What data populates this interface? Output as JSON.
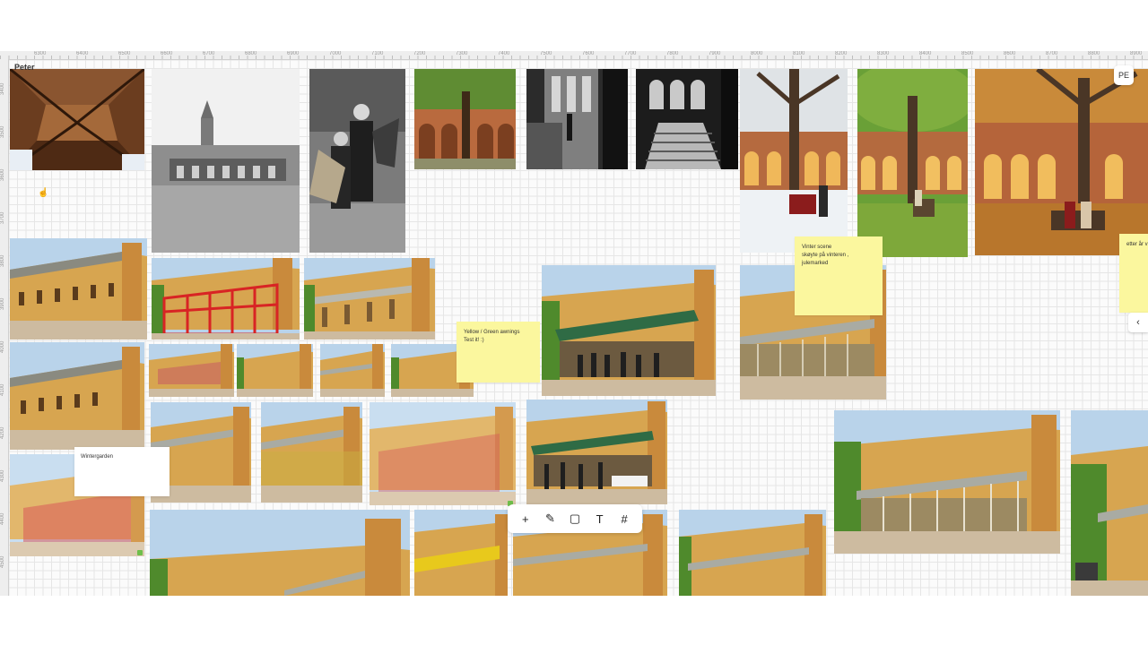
{
  "ruler": {
    "top_ticks": [
      "6300",
      "6400",
      "6500",
      "6600",
      "6700",
      "6800",
      "6900",
      "7000",
      "7100",
      "7200",
      "7300",
      "7400",
      "7500",
      "7600",
      "7700",
      "7800",
      "7900",
      "8000",
      "8100",
      "8200",
      "8300",
      "8400",
      "8500",
      "8600",
      "8700",
      "8800",
      "8900"
    ],
    "left_ticks": [
      "3400",
      "3500",
      "3600",
      "3700",
      "3800",
      "3900",
      "4000",
      "4100",
      "4200",
      "4300",
      "4400",
      "4500",
      "4600"
    ]
  },
  "cursor": {
    "user_label": "Peter"
  },
  "avatar": {
    "initials": "PE"
  },
  "sticky_notes": [
    {
      "text_lines": [
        "Vinter scene",
        "skøyte på vinteren ,",
        "julemarked"
      ]
    },
    {
      "text_lines": [
        "Yellow / Green awnings",
        "Test it! :)"
      ]
    },
    {
      "text_lines": [
        "etter år v"
      ]
    }
  ],
  "cards": [
    {
      "label": "Wintergarden"
    }
  ],
  "toolbar": {
    "tools": [
      {
        "name": "add",
        "glyph": "+"
      },
      {
        "name": "pen",
        "glyph": "✎"
      },
      {
        "name": "sticky-note",
        "glyph": "▢"
      },
      {
        "name": "text",
        "glyph": "T"
      },
      {
        "name": "frame",
        "glyph": "#"
      }
    ]
  },
  "side_tab": {
    "glyph": "‹"
  },
  "colors": {
    "sky": "#b9d3ea",
    "building_ochre": "#d7a550",
    "roof_gray": "#8a8a80",
    "ground": "#cdbba0",
    "red_markup": "#d82424",
    "green_awning": "#2f6b45",
    "tree_green": "#6f9a3a",
    "autumn_ground": "#b8762c",
    "sticky_yellow": "#fbf79e"
  },
  "images": [
    "courtyard-ceiling-photo",
    "historic-pavilion-bw-photo",
    "historic-children-bw-photo",
    "tree-arches-photo",
    "cloister-bw-photo-1",
    "cloister-bw-photo-2",
    "winter-tree-photo",
    "summer-tree-photo",
    "autumn-tree-photo",
    "courtyard-photo-1",
    "courtyard-red-markup-photo",
    "courtyard-photo-2",
    "courtyard-green-awning-photo",
    "courtyard-winter-garden-photo",
    "courtyard-photo-3",
    "courtyard-thumb-1",
    "courtyard-thumb-2",
    "courtyard-thumb-3",
    "courtyard-thumb-4",
    "courtyard-photo-4",
    "courtyard-photo-5",
    "courtyard-red-overlay-photo",
    "courtyard-event-photo",
    "courtyard-glasshouse-photo",
    "courtyard-red-photo",
    "courtyard-wide-photo",
    "courtyard-yellow-photo",
    "courtyard-photo-6",
    "courtyard-photo-7",
    "courtyard-edge-photo"
  ]
}
